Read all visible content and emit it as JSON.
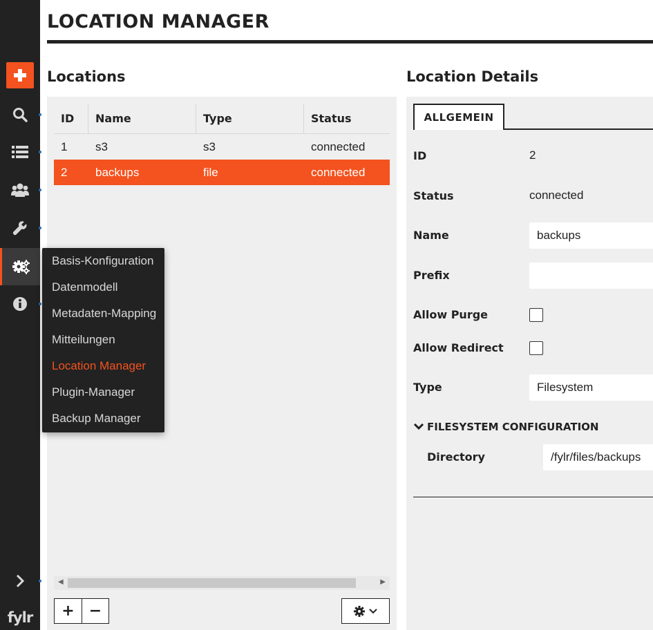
{
  "page": {
    "title": "LOCATION MANAGER",
    "accent_color": "#f4521e"
  },
  "sidebar": {
    "logo": "fylr",
    "items": [
      {
        "icon": "plus-icon"
      },
      {
        "icon": "search-icon"
      },
      {
        "icon": "list-icon"
      },
      {
        "icon": "users-icon"
      },
      {
        "icon": "wrench-icon"
      },
      {
        "icon": "gears-icon",
        "active": true
      },
      {
        "icon": "info-icon"
      },
      {
        "icon": "chevron-right-icon"
      }
    ]
  },
  "menu": {
    "items": [
      {
        "label": "Basis-Konfiguration"
      },
      {
        "label": "Datenmodell"
      },
      {
        "label": "Metadaten-Mapping"
      },
      {
        "label": "Mitteilungen"
      },
      {
        "label": "Location Manager",
        "active": true
      },
      {
        "label": "Plugin-Manager"
      },
      {
        "label": "Backup Manager"
      }
    ]
  },
  "locations": {
    "title": "Locations",
    "columns": [
      "ID",
      "Name",
      "Type",
      "Status"
    ],
    "rows": [
      {
        "id": "1",
        "name": "s3",
        "type": "s3",
        "status": "connected",
        "selected": false
      },
      {
        "id": "2",
        "name": "backups",
        "type": "file",
        "status": "connected",
        "selected": true
      }
    ],
    "buttons": {
      "add": "+",
      "remove": "−"
    }
  },
  "details": {
    "title": "Location Details",
    "tab": "ALLGEMEIN",
    "fields": {
      "id_label": "ID",
      "id_value": "2",
      "status_label": "Status",
      "status_value": "connected",
      "name_label": "Name",
      "name_value": "backups",
      "prefix_label": "Prefix",
      "prefix_value": "",
      "allow_purge_label": "Allow Purge",
      "allow_purge_checked": false,
      "allow_redirect_label": "Allow Redirect",
      "allow_redirect_checked": false,
      "type_label": "Type",
      "type_value": "Filesystem"
    },
    "fs_section": {
      "title": "FILESYSTEM CONFIGURATION",
      "directory_label": "Directory",
      "directory_value": "/fylr/files/backups"
    }
  }
}
